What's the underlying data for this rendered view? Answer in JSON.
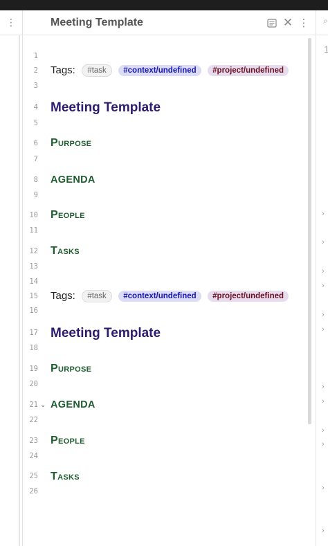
{
  "pane": {
    "title": "Meeting Template"
  },
  "icons": {
    "left_more": "more-vertical-icon",
    "reading_view": "book-icon",
    "close": "close-icon",
    "pane_more": "more-vertical-icon",
    "search": "search-icon",
    "fold_toggle": "chevron-down-icon",
    "collapse": "chevron-right-icon"
  },
  "right_panel": {
    "number": "1"
  },
  "editor": {
    "line_numbers": [
      "1",
      "2",
      "3",
      "4",
      "5",
      "6",
      "7",
      "8",
      "9",
      "10",
      "11",
      "12",
      "13",
      "14",
      "15",
      "16",
      "17",
      "18",
      "19",
      "20",
      "21",
      "22",
      "23",
      "24",
      "25",
      "26"
    ],
    "blocks": [
      {
        "tags_label": "Tags:",
        "tags": [
          "#task",
          "#context/undefined",
          "#project/undefined"
        ],
        "title": "Meeting Template",
        "purpose": "Purpose",
        "agenda": "AGENDA",
        "people": "People",
        "tasks": "Tasks"
      },
      {
        "tags_label": "Tags:",
        "tags": [
          "#task",
          "#context/undefined",
          "#project/undefined"
        ],
        "title": "Meeting Template",
        "purpose": "Purpose",
        "agenda": "AGENDA",
        "people": "People",
        "tasks": "Tasks"
      }
    ]
  },
  "colors": {
    "heading1": "#2d1b6e",
    "heading2": "#1e5c2f",
    "tag_context_text": "#1616b5",
    "tag_project_text": "#6a1020"
  }
}
